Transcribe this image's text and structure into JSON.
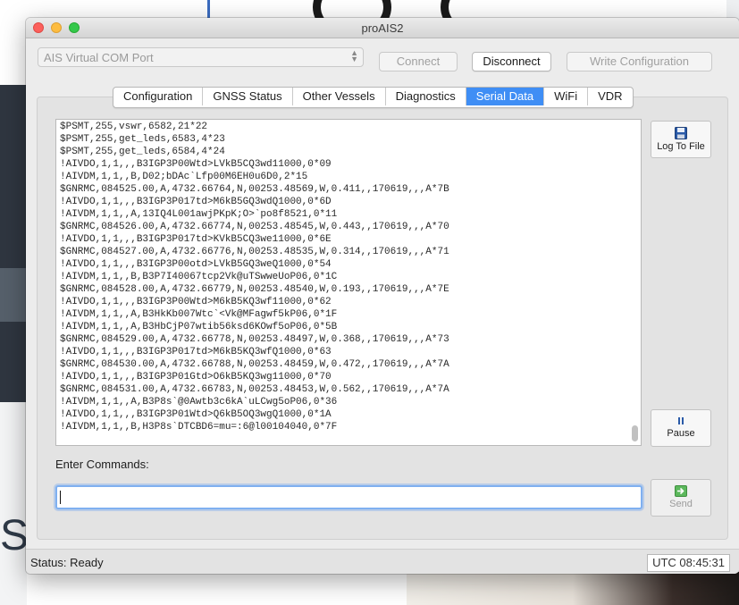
{
  "window": {
    "title": "proAIS2"
  },
  "connection": {
    "port": "AIS Virtual COM Port",
    "connect_label": "Connect",
    "disconnect_label": "Disconnect",
    "write_config_label": "Write Configuration"
  },
  "tabs": [
    {
      "label": "Configuration",
      "active": false
    },
    {
      "label": "GNSS Status",
      "active": false
    },
    {
      "label": "Other Vessels",
      "active": false
    },
    {
      "label": "Diagnostics",
      "active": false
    },
    {
      "label": "Serial Data",
      "active": true
    },
    {
      "label": "WiFi",
      "active": false
    },
    {
      "label": "VDR",
      "active": false
    }
  ],
  "serial_log": [
    "$PSMT,255,vswr,6582,21*22",
    "$PSMT,255,get_leds,6583,4*23",
    "$PSMT,255,get_leds,6584,4*24",
    "!AIVDO,1,1,,,B3IGP3P00Wtd>LVkB5CQ3wd11000,0*09",
    "!AIVDM,1,1,,B,D02;bDAc`Lfp00M6EH0u6D0,2*15",
    "$GNRMC,084525.00,A,4732.66764,N,00253.48569,W,0.411,,170619,,,A*7B",
    "!AIVDO,1,1,,,B3IGP3P017td>M6kB5GQ3wdQ1000,0*6D",
    "!AIVDM,1,1,,A,13IQ4L001awjPKpK;O>`po8f8521,0*11",
    "$GNRMC,084526.00,A,4732.66774,N,00253.48545,W,0.443,,170619,,,A*70",
    "!AIVDO,1,1,,,B3IGP3P017td>KVkB5CQ3we11000,0*6E",
    "$GNRMC,084527.00,A,4732.66776,N,00253.48535,W,0.314,,170619,,,A*71",
    "!AIVDO,1,1,,,B3IGP3P00otd>LVkB5GQ3weQ1000,0*54",
    "!AIVDM,1,1,,B,B3P7I40067tcp2Vk@uTSwweUoP06,0*1C",
    "$GNRMC,084528.00,A,4732.66779,N,00253.48540,W,0.193,,170619,,,A*7E",
    "!AIVDO,1,1,,,B3IGP3P00Wtd>M6kB5KQ3wf11000,0*62",
    "!AIVDM,1,1,,A,B3HkKb007Wtc`<Vk@MFagwf5kP06,0*1F",
    "!AIVDM,1,1,,A,B3HbCjP07wtib56ksd6KOwf5oP06,0*5B",
    "$GNRMC,084529.00,A,4732.66778,N,00253.48497,W,0.368,,170619,,,A*73",
    "!AIVDO,1,1,,,B3IGP3P017td>M6kB5KQ3wfQ1000,0*63",
    "$GNRMC,084530.00,A,4732.66788,N,00253.48459,W,0.472,,170619,,,A*7A",
    "!AIVDO,1,1,,,B3IGP3P01Gtd>O6kB5KQ3wg11000,0*70",
    "$GNRMC,084531.00,A,4732.66783,N,00253.48453,W,0.562,,170619,,,A*7A",
    "!AIVDM,1,1,,A,B3P8s`@0Awtb3c6kA`uLCwg5oP06,0*36",
    "!AIVDO,1,1,,,B3IGP3P01Wtd>Q6kB5OQ3wgQ1000,0*1A",
    "!AIVDM,1,1,,B,H3P8s`DTCBD6=mu=:6@l00104040,0*7F"
  ],
  "side_buttons": {
    "log_to_file": "Log To File",
    "pause": "Pause",
    "send": "Send"
  },
  "commands": {
    "label": "Enter Commands:",
    "value": ""
  },
  "status": {
    "text": "Status: Ready",
    "clock": "UTC  08:45:31"
  },
  "icons": {
    "log_to_file": "floppy-disk-icon",
    "pause": "pause-icon",
    "send": "send-arrow-icon"
  },
  "colors": {
    "active_tab": "#3f8ef5",
    "focus_ring": "#7fb0f0",
    "send_icon": "#5cb85c"
  }
}
